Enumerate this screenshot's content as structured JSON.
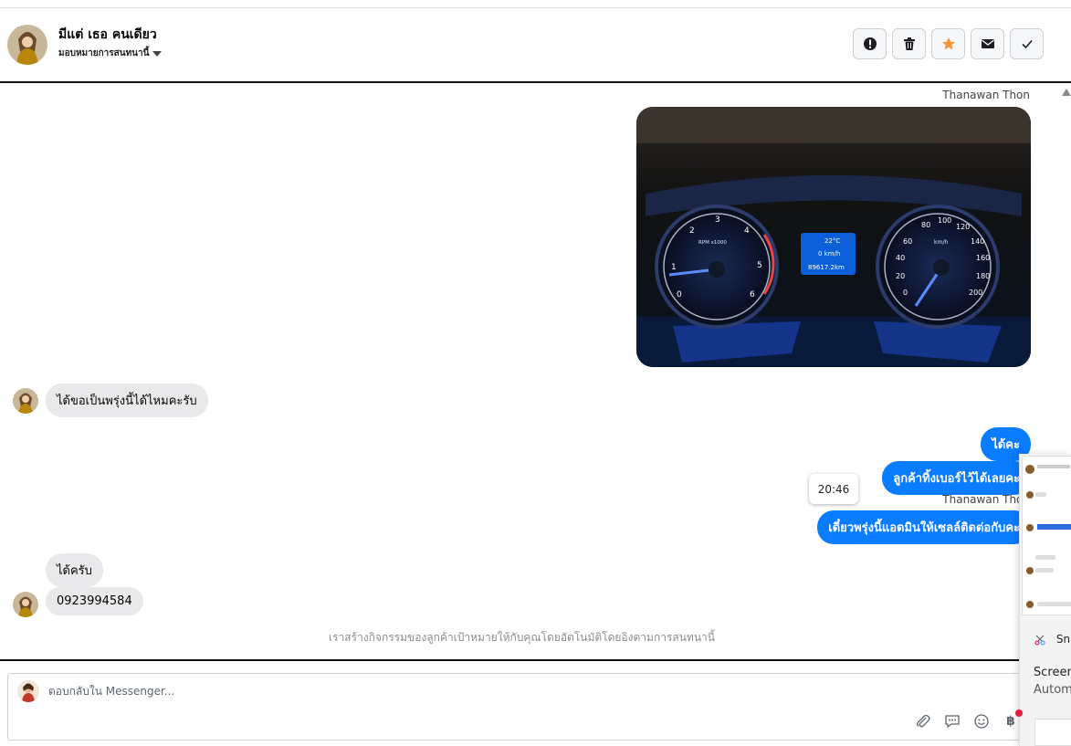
{
  "header": {
    "name": "มีแต่ เธอ คนเดียว",
    "assign_label": "มอบหมายการสนทนานี้",
    "actions": [
      {
        "name": "report-button",
        "icon": "exclamation-icon"
      },
      {
        "name": "delete-button",
        "icon": "trash-icon"
      },
      {
        "name": "star-button",
        "icon": "star-icon"
      },
      {
        "name": "mark-unread-button",
        "icon": "envelope-icon"
      },
      {
        "name": "mark-done-button",
        "icon": "check-icon"
      }
    ]
  },
  "chat": {
    "photo_sender": "Thanawan Thon",
    "photo_readout": {
      "temp": "22°C",
      "speed": "0 km/h",
      "odo": "89617.2km",
      "tach_unit": "RPM x1000",
      "speed_unit": "km/h"
    },
    "msg_in_1": "ได้ขอเป็นพรุ่งนี้ได้ไหมคะรับ",
    "msg_out_1": "ได้คะ",
    "msg_out_2": "ลูกค้าทิ้งเบอร์ไว้ได้เลยคะ",
    "timestamp": "20:46",
    "sender_2": "Thanawan Thon",
    "msg_out_3": "เดี๋ยวพรุ่งนี้แอดมินให้เซลล์ติดต่อกับคะ",
    "msg_in_2": "ได้ครับ",
    "msg_in_3": "0923994584",
    "footer_note": "เราสร้างกิจกรรมของลูกค้าเป้าหมายให้กับคุณโดยอัตโนมัติโดยอิงตามการสนทนานี้"
  },
  "composer": {
    "placeholder": "ตอบกลับใน Messenger..."
  },
  "snip_popup": {
    "app_label": "Sni",
    "line1": "Screen",
    "line2": "Autom"
  },
  "colors": {
    "accent": "#0a7cff",
    "incoming_bubble": "#e9e9eb",
    "star": "#f7923a"
  }
}
